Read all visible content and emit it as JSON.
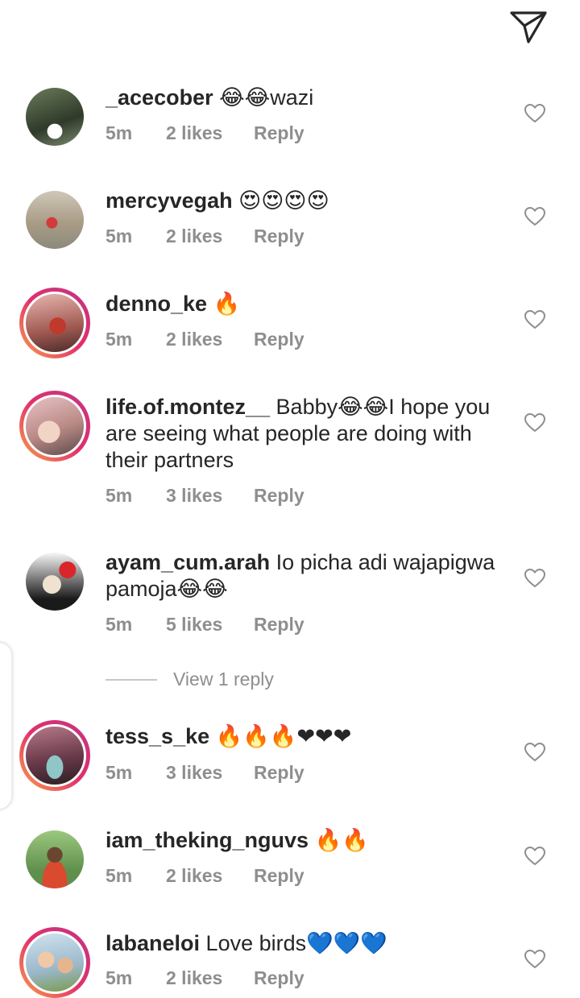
{
  "header": {
    "send_icon": "send-icon"
  },
  "comments": [
    {
      "username": "_acecober",
      "text": "😂😂wazi",
      "time": "5m",
      "likes": "2 likes",
      "reply": "Reply",
      "story_ring": false
    },
    {
      "username": "mercyvegah",
      "text": "😍😍😍😍",
      "time": "5m",
      "likes": "2 likes",
      "reply": "Reply",
      "story_ring": false
    },
    {
      "username": "denno_ke",
      "text": "🔥",
      "time": "5m",
      "likes": "2 likes",
      "reply": "Reply",
      "story_ring": true
    },
    {
      "username": "life.of.montez__",
      "text": "Babby😂😂I hope you are seeing what people are doing with their partners",
      "time": "5m",
      "likes": "3 likes",
      "reply": "Reply",
      "story_ring": true
    },
    {
      "username": "ayam_cum.arah",
      "text": "Io picha adi wajapigwa pamoja😂😂",
      "time": "5m",
      "likes": "5 likes",
      "reply": "Reply",
      "story_ring": false,
      "view_replies": "View 1 reply"
    },
    {
      "username": "tess_s_ke",
      "text": "🔥🔥🔥❤❤❤",
      "time": "5m",
      "likes": "3 likes",
      "reply": "Reply",
      "story_ring": true
    },
    {
      "username": "iam_theking_nguvs",
      "text": "🔥🔥",
      "time": "5m",
      "likes": "2 likes",
      "reply": "Reply",
      "story_ring": false
    },
    {
      "username": "labaneloi",
      "text": "Love birds💙💙💙",
      "time": "5m",
      "likes": "2 likes",
      "reply": "Reply",
      "story_ring": true
    }
  ],
  "colors": {
    "username": "#262626",
    "meta": "#8e8e8e",
    "story_gradient_start": "#f9a14a",
    "story_gradient_end": "#c13584"
  }
}
